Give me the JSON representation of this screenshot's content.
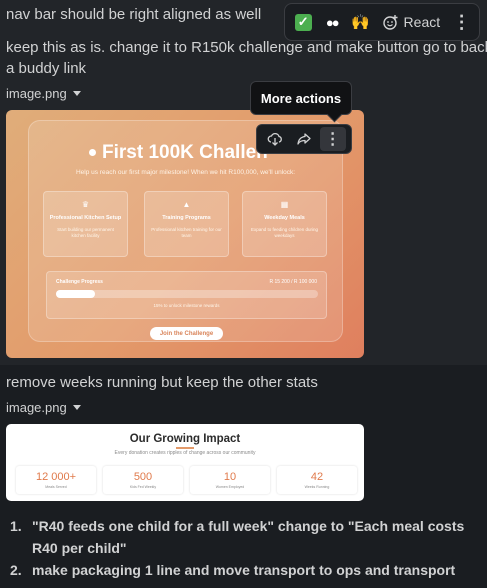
{
  "messages": {
    "line_nav": "nav bar should be right aligned as well",
    "line_keep_1": "keep this as is. change it to R150k challenge and make button go to back",
    "line_keep_2": "a buddy link",
    "line_remove": "remove weeks running but keep the other stats"
  },
  "toolbar": {
    "react_label": "React",
    "emojis": [
      "check-mark",
      "eyes",
      "raised-hands"
    ]
  },
  "files": [
    {
      "name": "image.png"
    },
    {
      "name": "image.png"
    }
  ],
  "tooltip": {
    "label": "More actions"
  },
  "image1": {
    "title": "First 100K Challen",
    "subtitle": "Help us reach our first major milestone! When we hit R100,000, we'll unlock:",
    "boxes": [
      {
        "icon": "chef-hat",
        "title": "Professional Kitchen Setup",
        "desc": "Start building our permanent kitchen facility"
      },
      {
        "icon": "graduation-cap",
        "title": "Training Programs",
        "desc": "Professional kitchen training for our team"
      },
      {
        "icon": "calendar",
        "title": "Weekday Meals",
        "desc": "Expand to feeding children during weekdays"
      }
    ],
    "progress_label": "Challenge Progress",
    "progress_amount": "R 15 200 / R 100 000",
    "progress_fraction": 0.15,
    "progress_note": "15% to unlock milestone rewards",
    "button": "Join the Challenge"
  },
  "image2": {
    "title": "Our Growing Impact",
    "subtitle": "Every donation creates ripples of change across our community",
    "stats": [
      {
        "value": "12 000+",
        "label": "Meals Served"
      },
      {
        "value": "500",
        "label": "Kids Fed Weekly"
      },
      {
        "value": "10",
        "label": "Women Employed"
      },
      {
        "value": "42",
        "label": "Weeks Running"
      }
    ]
  },
  "list": [
    {
      "num": "1.",
      "text": "\"R40 feeds one child for a full week\" change to \"Each meal costs R40 per child\""
    },
    {
      "num": "2.",
      "text": "make packaging 1 line and move transport to ops and transport"
    }
  ]
}
